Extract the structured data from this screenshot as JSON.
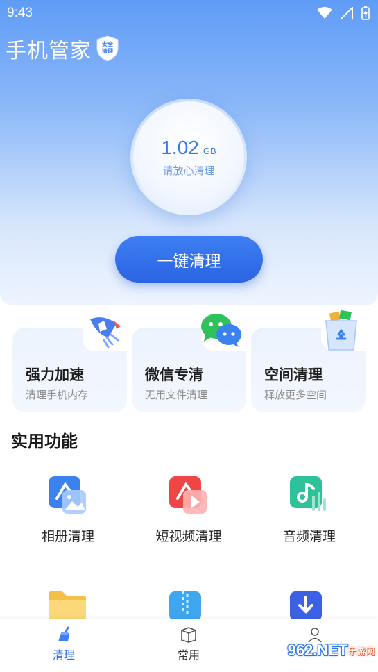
{
  "status_bar": {
    "time": "9:43"
  },
  "header": {
    "app_title": "手机管家",
    "badge_line1": "安全",
    "badge_line2": "清理"
  },
  "storage": {
    "value": "1.02",
    "unit": "GB",
    "caption": "请放心清理"
  },
  "primary_action": {
    "label": "一键清理"
  },
  "feature_cards": [
    {
      "title": "强力加速",
      "subtitle": "清理手机内存",
      "icon": "rocket-icon"
    },
    {
      "title": "微信专清",
      "subtitle": "无用文件清理",
      "icon": "wechat-icon"
    },
    {
      "title": "空间清理",
      "subtitle": "释放更多空间",
      "icon": "trash-can-icon"
    }
  ],
  "tools_section": {
    "title": "实用功能",
    "items": [
      {
        "label": "相册清理",
        "icon": "photo-album-icon",
        "color": "#3b82f0"
      },
      {
        "label": "短视频清理",
        "icon": "short-video-icon",
        "color": "#f04545"
      },
      {
        "label": "音频清理",
        "icon": "music-note-icon",
        "color": "#2ec29a"
      }
    ],
    "partial_row_icons": [
      "folder-icon",
      "zip-file-icon",
      "download-icon"
    ]
  },
  "bottom_nav": [
    {
      "label": "清理",
      "active": true,
      "icon": "broom-icon"
    },
    {
      "label": "常用",
      "active": false,
      "icon": "box-icon"
    },
    {
      "label": "",
      "active": false,
      "icon": "profile-icon"
    }
  ],
  "watermark": {
    "text": "962.NET",
    "sub": "乐游网"
  },
  "colors": {
    "accent": "#2a64e3",
    "active_tab": "#2f6fe8",
    "inactive_tab": "#333333"
  }
}
